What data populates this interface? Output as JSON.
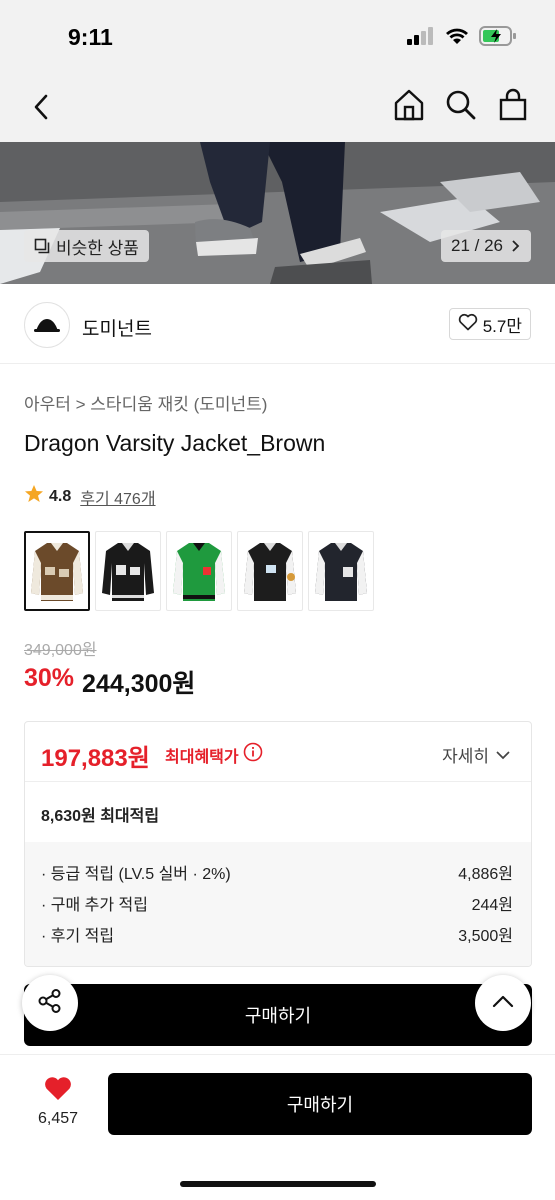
{
  "status_bar": {
    "time": "9:11",
    "icons": [
      "signal-icon",
      "wifi-icon",
      "battery-charging-icon"
    ]
  },
  "nav": {
    "icons": [
      "back-icon",
      "home-icon",
      "search-icon",
      "bag-icon"
    ]
  },
  "gallery": {
    "similar_label": "비슷한 상품",
    "counter": "21 / 26"
  },
  "brand": {
    "name": "도미넌트",
    "likes": "5.7만"
  },
  "product": {
    "category": "아우터 > 스타디움 재킷 (도미넌트)",
    "title": "Dragon Varsity Jacket_Brown",
    "rating": "4.8",
    "reviews": "후기 476개",
    "swatches": [
      {
        "name": "brown",
        "body": "#6b4a2a",
        "sleeve": "#efe9dd"
      },
      {
        "name": "black-black",
        "body": "#1a1a1a",
        "sleeve": "#1a1a1a"
      },
      {
        "name": "green",
        "body": "#1f9a3e",
        "sleeve": "#f3f3f3"
      },
      {
        "name": "black-white",
        "body": "#1d1d1d",
        "sleeve": "#f2f2f2"
      },
      {
        "name": "navy-white",
        "body": "#22252d",
        "sleeve": "#f2f2f2"
      }
    ]
  },
  "price": {
    "original": "349,000원",
    "discount": "30%",
    "sale": "244,300원"
  },
  "benefit": {
    "max_price": "197,883원",
    "max_label": "최대혜택가",
    "detail_label": "자세히",
    "points_total": "8,630원 최대적립",
    "rows": [
      {
        "label": "· 등급 적립 (LV.5 실버 · 2%)",
        "value": "4,886원"
      },
      {
        "label": "· 구매 추가 적립",
        "value": "244원"
      },
      {
        "label": "· 후기 적립",
        "value": "3,500원"
      }
    ]
  },
  "actions": {
    "buy_label": "구매하기",
    "buy_main_label": "구매하기",
    "wish_count": "6,457"
  },
  "colors": {
    "accent_red": "#e5202a",
    "button_black": "#000000",
    "star": "#f5a623"
  }
}
